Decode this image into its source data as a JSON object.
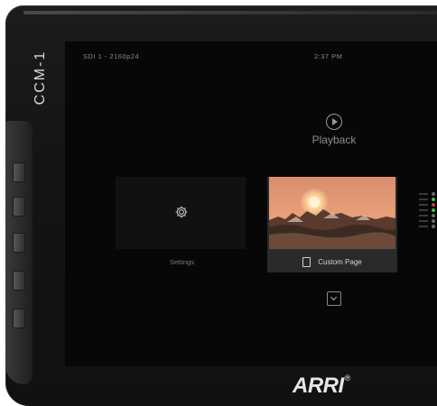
{
  "device": {
    "brand": "CCM-1",
    "logo": "ARRI",
    "logo_mark": "®"
  },
  "status_bar": {
    "signal": "SDI 1 - 2160p24",
    "time": "2:37 PM"
  },
  "playback": {
    "label": "Playback",
    "icon": "play-circle-icon"
  },
  "tiles": {
    "settings": {
      "label": "Settings",
      "icon": "gear-icon"
    },
    "custom_page": {
      "label": "Custom Page",
      "icon": "page-icon"
    }
  },
  "more": {
    "icon": "chevron-down-icon"
  },
  "colors": {
    "screen_bg": "#070708",
    "tile_bg": "#111113",
    "selected_tile_bg": "#2a2a2c",
    "text_muted": "#8a8a8a",
    "sunset_orange": "#e58a5a"
  }
}
